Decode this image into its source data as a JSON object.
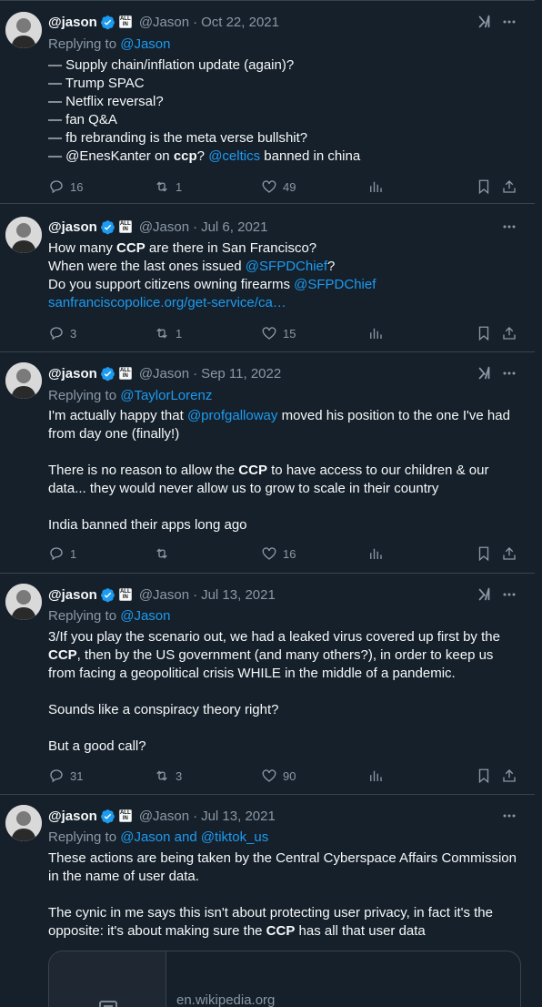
{
  "colors": {
    "background": "#15202b",
    "text": "#f7f9f9",
    "muted": "#8b98a5",
    "link": "#1d9bf0",
    "verified": "#1d9bf0",
    "divider": "#38444d"
  },
  "tweets": [
    {
      "name": "@jason",
      "handle": "@Jason",
      "date": "Oct 22, 2021",
      "replying_prefix": "Replying to",
      "replying_to": "@Jason",
      "lines": [
        "— Supply chain/inflation update (again)?",
        "— Trump SPAC",
        "— Netflix reversal?",
        "— fan Q&A",
        "— fb rebranding is the meta verse bullshit?"
      ],
      "last_line": {
        "t1": "— @EnesKanter on ",
        "t2": "ccp",
        "t3": "? ",
        "t4": "@celtics",
        "t5": " banned in china"
      },
      "replies": "16",
      "retweets": "1",
      "likes": "49"
    },
    {
      "name": "@jason",
      "handle": "@Jason",
      "date": "Jul 6, 2021",
      "line1": {
        "t1": "How many ",
        "t2": "CCP",
        "t3": " are there in San Francisco?"
      },
      "line2": {
        "t1": "When were the last ones issued ",
        "t2": "@SFPDChief",
        "t3": "?"
      },
      "line3": {
        "t1": "Do you support citizens owning firearms ",
        "t2": "@SFPDChief"
      },
      "link": "sanfranciscopolice.org/get-service/ca…",
      "replies": "3",
      "retweets": "1",
      "likes": "15"
    },
    {
      "name": "@jason",
      "handle": "@Jason",
      "date": "Sep 11, 2022",
      "replying_prefix": "Replying to",
      "replying_to": "@TaylorLorenz",
      "para1": {
        "t1": "I'm actually happy that ",
        "t2": "@profgalloway",
        "t3": " moved his position to the one I've had from day one (finally!)"
      },
      "para2": {
        "t1": "There is no reason to allow the ",
        "t2": "CCP",
        "t3": " to have access to our children & our data... they would never allow us to grow to scale in their country"
      },
      "para3": "India banned their apps long ago",
      "replies": "1",
      "retweets": "",
      "likes": "16"
    },
    {
      "name": "@jason",
      "handle": "@Jason",
      "date": "Jul 13, 2021",
      "replying_prefix": "Replying to",
      "replying_to": "@Jason",
      "para1": {
        "t1": "3/If you play the scenario out, we had a leaked virus covered up first by the ",
        "t2": "CCP",
        "t3": ", then by the US government (and many others?), in order to keep us from facing a geopolitical crisis WHILE in the middle of a pandemic."
      },
      "para2": "Sounds like a conspiracy theory right?",
      "para3": "But a good call?",
      "replies": "31",
      "retweets": "3",
      "likes": "90"
    },
    {
      "name": "@jason",
      "handle": "@Jason",
      "date": "Jul 13, 2021",
      "replying_prefix": "Replying to",
      "replying_to": "@Jason and @tiktok_us",
      "para1": "These actions are being taken by the Central Cyberspace Affairs Commission in the name of user data.",
      "para2": {
        "t1": "The cynic in me says this isn't about protecting user privacy, in fact it's the opposite: it's about making sure the ",
        "t2": "CCP",
        "t3": " has all that user data"
      },
      "card_domain": "en.wikipedia.org"
    }
  ],
  "affiliate_badge": {
    "top": "ALL",
    "bottom": "IN"
  }
}
